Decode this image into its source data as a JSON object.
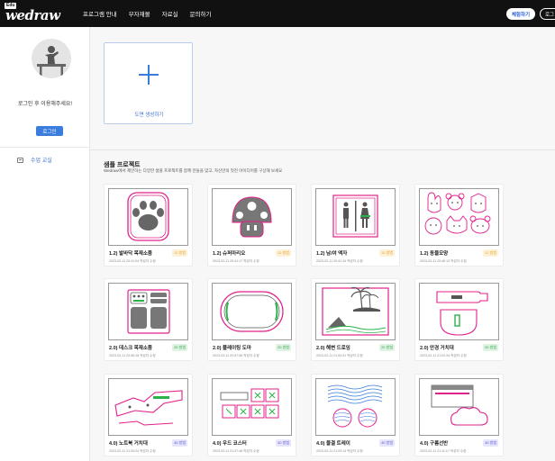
{
  "logo": {
    "edu": "Edu",
    "wordmark": "wedraw"
  },
  "nav": {
    "items": [
      "프로그램 안내",
      "부자재몰",
      "자료실",
      "문의하기"
    ],
    "start_label": "체험하기",
    "login_label": "로그"
  },
  "sidebar": {
    "login_message": "로그인 후 이용해주세요!",
    "login_button": "로그인",
    "menu_item": "수업 교실"
  },
  "new_project": {
    "label": "도면 생성하기"
  },
  "samples": {
    "title": "샘플 프로젝트",
    "subtitle": "Wedraw에서 제안하는 다양한 샘플 프로젝트를 함께 만들을 맞고, 자신만의 멋진 아이디어를 구상해 보세요",
    "cards": [
      {
        "title": "1.2) 발바닥 목재소품",
        "date": "2023-02-11 20:41:04 작성자 수정",
        "badge": "12 방법",
        "badgeColor": "#e8a21c",
        "badgeBg": "#fdf1d9"
      },
      {
        "title": "1.2) 슈퍼마리오",
        "date": "2023-02-11 20:41:17 작성자 수정",
        "badge": "12 방법",
        "badgeColor": "#e8a21c",
        "badgeBg": "#fdf1d9"
      },
      {
        "title": "1.2) 남/여 액자",
        "date": "2023-02-11 20:41:34 작성자 수정",
        "badge": "12 방법",
        "badgeColor": "#e8a21c",
        "badgeBg": "#fdf1d9"
      },
      {
        "title": "1.2) 동물모양",
        "date": "2023-02-11 20:46:13 작성자 수정",
        "badge": "12 방법",
        "badgeColor": "#e8a21c",
        "badgeBg": "#fdf1d9"
      },
      {
        "title": "2.0) 데스크 목재소품",
        "date": "2023-02-11 20:55:18 작성자 수정",
        "badge": "20 방법",
        "badgeColor": "#2e9e4a",
        "badgeBg": "#dff3e3"
      },
      {
        "title": "2.0) 플레이팅 도마",
        "date": "2023-02-11 20:57:58 작성자 수정",
        "badge": "20 방법",
        "badgeColor": "#2e9e4a",
        "badgeBg": "#dff3e3"
      },
      {
        "title": "2.0) 해변 드로잉",
        "date": "2023-02-11 21:00:51 작성자 수정",
        "badge": "20 방법",
        "badgeColor": "#2e9e4a",
        "badgeBg": "#dff3e3"
      },
      {
        "title": "2.0) 안경 거치대",
        "date": "2023-02-11 21:02:34 작성자 수정",
        "badge": "20 방법",
        "badgeColor": "#2e9e4a",
        "badgeBg": "#dff3e3"
      },
      {
        "title": "4.0) 노트북 거치대",
        "date": "2023-02-11 21:05:24 작성자 수정",
        "badge": "40 방법",
        "badgeColor": "#5a55d6",
        "badgeBg": "#e6e5fb"
      },
      {
        "title": "4.0) 우드 코스터",
        "date": "2023-02-11 21:07:48 작성자 수정",
        "badge": "40 방법",
        "badgeColor": "#5a55d6",
        "badgeBg": "#e6e5fb"
      },
      {
        "title": "4.0) 물결 트레이",
        "date": "2023-02-11 21:09:14 작성자 수정",
        "badge": "40 방법",
        "badgeColor": "#5a55d6",
        "badgeBg": "#e6e5fb"
      },
      {
        "title": "4.0) 구름선반",
        "date": "2023-02-11 21:11:17 작성자 수정",
        "badge": "40 방법",
        "badgeColor": "#5a55d6",
        "badgeBg": "#e6e5fb"
      }
    ]
  }
}
